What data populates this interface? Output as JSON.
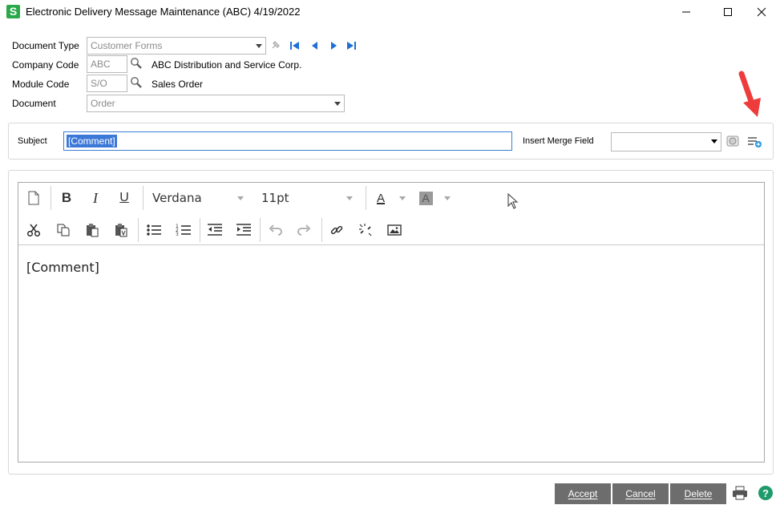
{
  "window": {
    "app_icon_letter": "S",
    "title": "Electronic Delivery Message Maintenance (ABC) 4/19/2022"
  },
  "form": {
    "document_type_label": "Document Type",
    "document_type_value": "Customer Forms",
    "company_code_label": "Company Code",
    "company_code_value": "ABC",
    "company_name": "ABC Distribution and Service Corp.",
    "module_code_label": "Module Code",
    "module_code_value": "S/O",
    "module_name": "Sales Order",
    "document_label": "Document",
    "document_value": "Order"
  },
  "subject": {
    "label": "Subject",
    "value": "[Comment]",
    "merge_field_label": "Insert Merge Field",
    "merge_field_value": ""
  },
  "editor": {
    "font_name": "Verdana",
    "font_size": "11pt",
    "font_color_glyph": "A",
    "highlight_glyph": "A",
    "bold_glyph": "B",
    "italic_glyph": "I",
    "underline_glyph": "U",
    "content": "[Comment]"
  },
  "footer": {
    "accept_label": "Accept",
    "cancel_label": "Cancel",
    "delete_label": "Delete"
  },
  "colors": {
    "accent_blue": "#1f6fd6",
    "arrow_red": "#ee3b3b",
    "button_gray": "#6d6d6d",
    "app_green": "#2aa84a",
    "help_green": "#1f9a6a"
  }
}
